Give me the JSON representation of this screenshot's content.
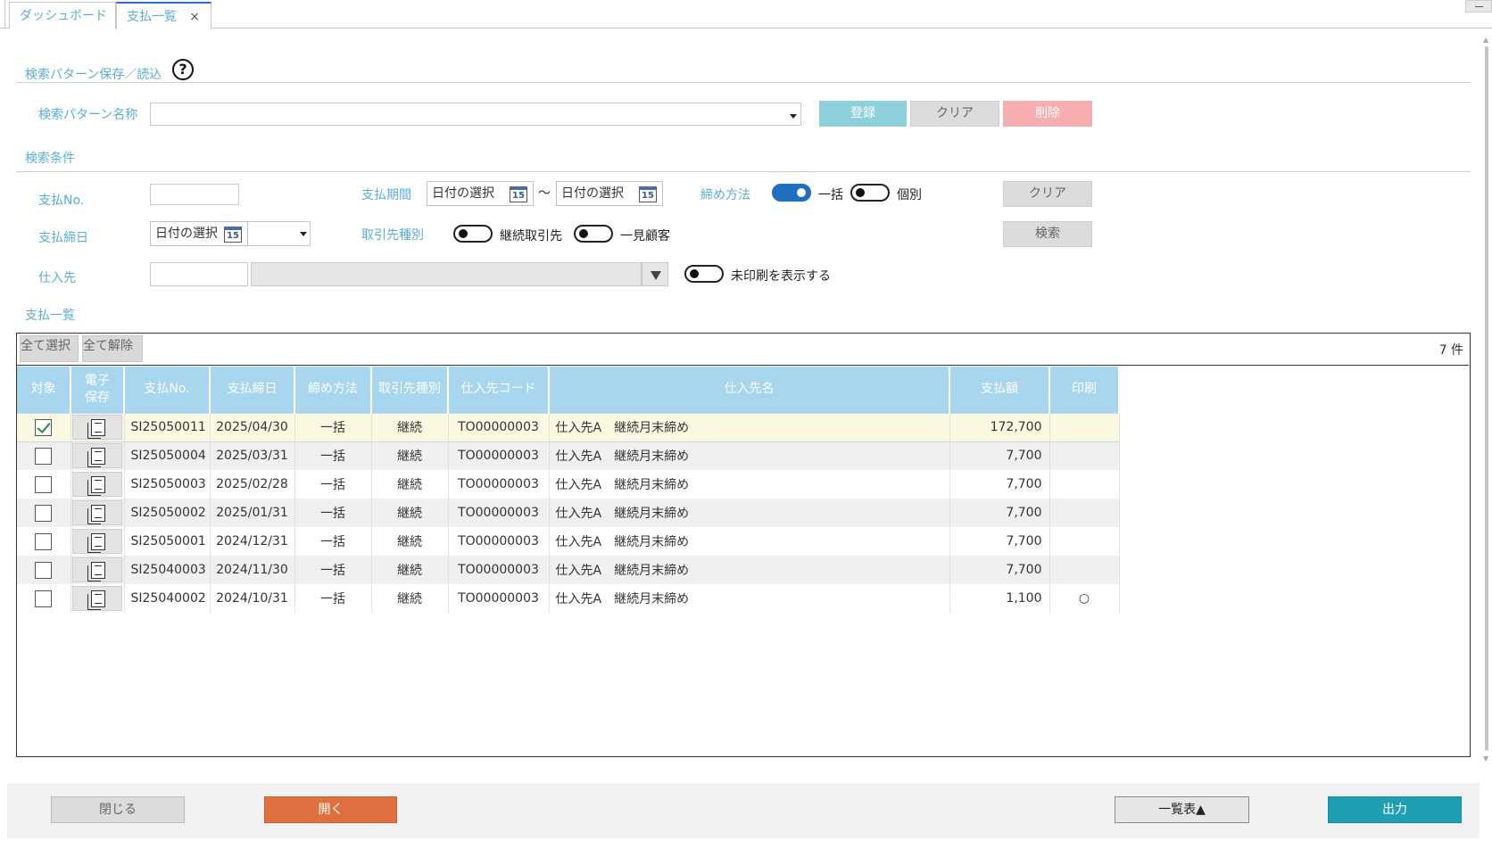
{
  "tabs": [
    {
      "label": "ダッシュボード"
    },
    {
      "label": "支払一覧",
      "close": "×"
    }
  ],
  "search_pattern": {
    "section_title": "検索パターン保存／読込",
    "help_symbol": "?",
    "name_label": "検索パターン名称",
    "name_value": "",
    "register_label": "登録",
    "clear_label": "クリア",
    "delete_label": "削除"
  },
  "conditions": {
    "section_title": "検索条件",
    "payment_no_label": "支払No.",
    "payment_no_value": "",
    "period_label": "支払期間",
    "date_placeholder": "日付の選択",
    "calendar_day": "15",
    "tilde": "～",
    "closing_method_label": "締め方法",
    "closing_method_options": [
      {
        "label": "一括",
        "on": true
      },
      {
        "label": "個別",
        "on": false
      }
    ],
    "clear_label": "クリア",
    "closing_date_label": "支払締日",
    "partner_type_label": "取引先種別",
    "partner_type_options": [
      {
        "label": "継続取引先",
        "on": false
      },
      {
        "label": "一見顧客",
        "on": false
      }
    ],
    "search_label": "検索",
    "supplier_label": "仕入先",
    "show_unprinted_label": "未印刷を表示する"
  },
  "list": {
    "section_title": "支払一覧",
    "select_all": "全て選択",
    "deselect_all": "全て解除",
    "count": "7 件",
    "columns": [
      "対象",
      "電子\n保存",
      "支払No.",
      "支払締日",
      "締め方法",
      "取引先種別",
      "仕入先コード",
      "仕入先名",
      "支払額",
      "印刷"
    ],
    "rows": [
      {
        "checked": true,
        "no": "SI25050011",
        "date": "2025/04/30",
        "method": "一括",
        "type": "継続",
        "code": "TO00000003",
        "name": "仕入先A　継続月末締め",
        "amount": "172,700",
        "printed": ""
      },
      {
        "checked": false,
        "no": "SI25050004",
        "date": "2025/03/31",
        "method": "一括",
        "type": "継続",
        "code": "TO00000003",
        "name": "仕入先A　継続月末締め",
        "amount": "7,700",
        "printed": ""
      },
      {
        "checked": false,
        "no": "SI25050003",
        "date": "2025/02/28",
        "method": "一括",
        "type": "継続",
        "code": "TO00000003",
        "name": "仕入先A　継続月末締め",
        "amount": "7,700",
        "printed": ""
      },
      {
        "checked": false,
        "no": "SI25050002",
        "date": "2025/01/31",
        "method": "一括",
        "type": "継続",
        "code": "TO00000003",
        "name": "仕入先A　継続月末締め",
        "amount": "7,700",
        "printed": ""
      },
      {
        "checked": false,
        "no": "SI25050001",
        "date": "2024/12/31",
        "method": "一括",
        "type": "継続",
        "code": "TO00000003",
        "name": "仕入先A　継続月末締め",
        "amount": "7,700",
        "printed": ""
      },
      {
        "checked": false,
        "no": "SI25040003",
        "date": "2024/11/30",
        "method": "一括",
        "type": "継続",
        "code": "TO00000003",
        "name": "仕入先A　継続月末締め",
        "amount": "7,700",
        "printed": ""
      },
      {
        "checked": false,
        "no": "SI25040002",
        "date": "2024/10/31",
        "method": "一括",
        "type": "継続",
        "code": "TO00000003",
        "name": "仕入先A　継続月末締め",
        "amount": "1,100",
        "printed": "○"
      }
    ]
  },
  "footer": {
    "close_label": "閉じる",
    "open_label": "開く",
    "list_label": "一覧表▲",
    "output_label": "出力"
  },
  "colors": {
    "accent_label": "#5aaed6",
    "header_bg": "#a9d6ef",
    "open_button": "#e0703f",
    "output_button": "#1f9fb4"
  }
}
